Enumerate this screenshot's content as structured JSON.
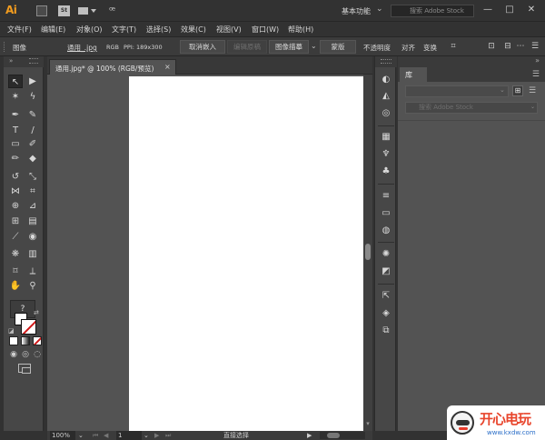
{
  "titlebar": {
    "app_logo": "Ai",
    "stock_badge": "St",
    "workspace": "基本功能",
    "stock_search_placeholder": "搜索 Adobe Stock",
    "window_min": "—",
    "window_max": "□",
    "window_close": "✕"
  },
  "menu": [
    "文件(F)",
    "编辑(E)",
    "对象(O)",
    "文字(T)",
    "选择(S)",
    "效果(C)",
    "视图(V)",
    "窗口(W)",
    "帮助(H)"
  ],
  "control_bar": {
    "object_type": "图像",
    "filename": "通用_.jpg",
    "color_mode": "RGB",
    "ppi": "PPI: 189x300",
    "embed_button": "取消嵌入",
    "edit_original_button": "编辑原稿",
    "image_trace_button": "图像描摹",
    "mask_button": "蒙版",
    "opacity_label": "不透明度",
    "align_label": "对齐",
    "transform_label": "变换"
  },
  "document": {
    "tab_label": "通用.jpg* @ 100% (RGB/预览)",
    "tab_close": "×"
  },
  "status_bar": {
    "zoom": "100%",
    "page": "1",
    "tool_status": "直接选择"
  },
  "tools": [
    {
      "name": "selection-tool-icon",
      "glyph": "▲"
    },
    {
      "name": "direct-selection-tool-icon",
      "glyph": "▶"
    },
    {
      "name": "magic-wand-tool-icon",
      "glyph": "✶"
    },
    {
      "name": "lasso-tool-icon",
      "glyph": "ϟ"
    },
    {
      "name": "pen-tool-icon",
      "glyph": "✒"
    },
    {
      "name": "curvature-tool-icon",
      "glyph": "✎"
    },
    {
      "name": "type-tool-icon",
      "glyph": "T"
    },
    {
      "name": "line-segment-tool-icon",
      "glyph": "/"
    },
    {
      "name": "rectangle-tool-icon",
      "glyph": "▭"
    },
    {
      "name": "paintbrush-tool-icon",
      "glyph": "✐"
    },
    {
      "name": "shaper-tool-icon",
      "glyph": "✏"
    },
    {
      "name": "eraser-tool-icon",
      "glyph": "◆"
    },
    {
      "name": "rotate-tool-icon",
      "glyph": "↺"
    },
    {
      "name": "scale-tool-icon",
      "glyph": "⤡"
    },
    {
      "name": "width-tool-icon",
      "glyph": "⋈"
    },
    {
      "name": "free-transform-tool-icon",
      "glyph": "⌗"
    },
    {
      "name": "shape-builder-tool-icon",
      "glyph": "⊕"
    },
    {
      "name": "perspective-grid-tool-icon",
      "glyph": "⊿"
    },
    {
      "name": "mesh-tool-icon",
      "glyph": "⊞"
    },
    {
      "name": "gradient-tool-icon",
      "glyph": "▤"
    },
    {
      "name": "eyedropper-tool-icon",
      "glyph": "⟋"
    },
    {
      "name": "blend-tool-icon",
      "glyph": "◉"
    },
    {
      "name": "symbol-sprayer-tool-icon",
      "glyph": "❋"
    },
    {
      "name": "column-graph-tool-icon",
      "glyph": "▥"
    },
    {
      "name": "artboard-tool-icon",
      "glyph": "⌑"
    },
    {
      "name": "slice-tool-icon",
      "glyph": "⟂"
    },
    {
      "name": "hand-tool-icon",
      "glyph": "✋"
    },
    {
      "name": "zoom-tool-icon",
      "glyph": "⚲"
    }
  ],
  "dock": [
    {
      "name": "color-guide-panel-icon",
      "glyph": "◐"
    },
    {
      "name": "color-panel-icon",
      "glyph": "◭"
    },
    {
      "name": "appearance-panel-icon",
      "glyph": "◎"
    },
    {
      "name": "swatches-panel-icon",
      "glyph": "▦"
    },
    {
      "name": "brushes-panel-icon",
      "glyph": "♆"
    },
    {
      "name": "symbols-panel-icon",
      "glyph": "♣"
    },
    {
      "name": "stroke-panel-icon",
      "glyph": "≡"
    },
    {
      "name": "gradient-panel-icon",
      "glyph": "▭"
    },
    {
      "name": "transparency-panel-icon",
      "glyph": "◍"
    },
    {
      "name": "graphic-styles-panel-icon",
      "glyph": "✺"
    },
    {
      "name": "image-trace-panel-icon",
      "glyph": "◩"
    },
    {
      "name": "export-panel-icon",
      "glyph": "⇱"
    },
    {
      "name": "layers-panel-icon",
      "glyph": "◈"
    },
    {
      "name": "artboards-panel-icon",
      "glyph": "⧉"
    }
  ],
  "library_panel": {
    "tab_label": "库",
    "search_placeholder": "搜索 Adobe Stock"
  },
  "watermark": {
    "title": "开心电玩",
    "subtitle": "www.kxdw.com"
  },
  "colors": {
    "ai_orange": "#f29c1f",
    "stroke_none_red": "#d01818",
    "watermark_red": "#e8452c",
    "watermark_blue": "#2c6fc8"
  }
}
